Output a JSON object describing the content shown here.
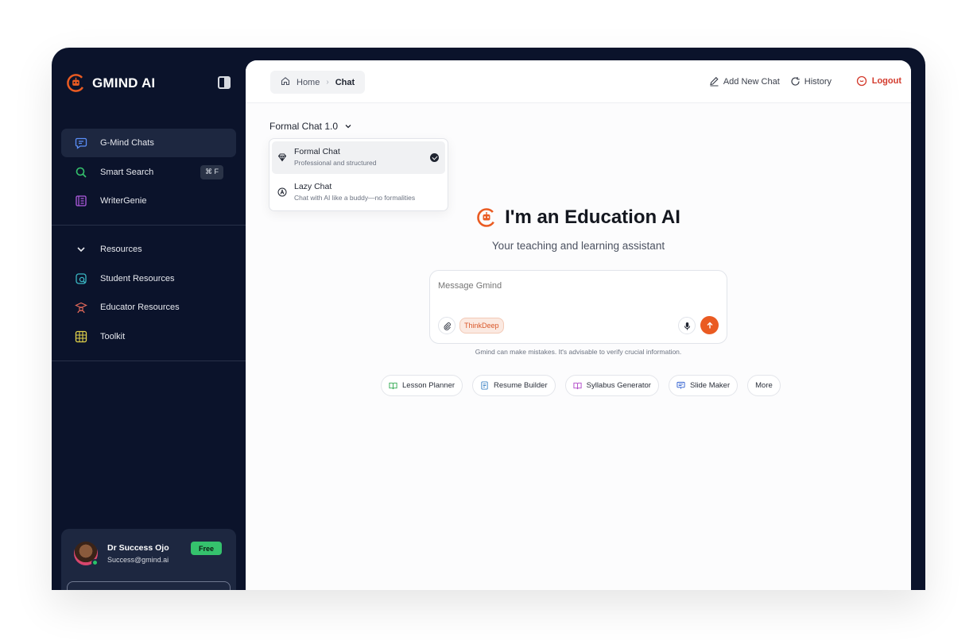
{
  "brand": {
    "name": "GMIND AI",
    "accent": "#ea5b22"
  },
  "sidebar": {
    "primary": [
      {
        "label": "G-Mind Chats",
        "icon": "chat-icon",
        "active": true
      },
      {
        "label": "Smart Search",
        "icon": "search-icon",
        "shortcut": "⌘ F"
      },
      {
        "label": "WriterGenie",
        "icon": "book-icon"
      }
    ],
    "resources_label": "Resources",
    "resources": [
      {
        "label": "Student Resources",
        "icon": "student-icon"
      },
      {
        "label": "Educator Resources",
        "icon": "graduation-cap-icon"
      },
      {
        "label": "Toolkit",
        "icon": "grid-icon"
      }
    ]
  },
  "user": {
    "name": "Dr Success Ojo",
    "email": "Success@gmind.ai",
    "plan": "Free"
  },
  "breadcrumb": {
    "home": "Home",
    "current": "Chat"
  },
  "top_actions": {
    "add_new_chat": "Add New Chat",
    "history": "History",
    "logout": "Logout"
  },
  "model": {
    "selected": "Formal Chat 1.0",
    "options": [
      {
        "title": "Formal Chat",
        "desc": "Professional and structured",
        "icon": "diamond-icon",
        "selected": true
      },
      {
        "title": "Lazy Chat",
        "desc": "Chat with AI like a buddy—no formalities",
        "icon": "a-circle-icon",
        "selected": false
      }
    ]
  },
  "hero": {
    "title": "I'm an Education AI",
    "subtitle": "Your teaching and learning assistant"
  },
  "composer": {
    "placeholder": "Message Gmind",
    "think_label": "ThinkDeep"
  },
  "disclaimer": "Gmind can make mistakes. It's advisable to verify crucial information.",
  "quick_tools": [
    {
      "label": "Lesson Planner",
      "icon": "open-book-icon",
      "color": "#2fa84f"
    },
    {
      "label": "Resume Builder",
      "icon": "document-icon",
      "color": "#3b82c4"
    },
    {
      "label": "Syllabus Generator",
      "icon": "book-icon",
      "color": "#b045c8"
    },
    {
      "label": "Slide Maker",
      "icon": "slides-icon",
      "color": "#2f5fd0"
    },
    {
      "label": "More",
      "icon": "",
      "color": ""
    }
  ]
}
